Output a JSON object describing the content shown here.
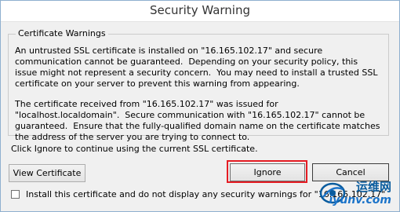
{
  "window": {
    "title": "Security Warning"
  },
  "warnings_group": {
    "legend": "Certificate Warnings",
    "paragraphs": [
      "An untrusted SSL certificate is installed on \"16.165.102.17\" and secure communication cannot be guaranteed.  Depending on your security policy, this issue might not represent a security concern.  You may need to install a trusted SSL certificate on your server to prevent this warning from appearing.",
      "The certificate received from \"16.165.102.17\" was issued for \"localhost.localdomain\".  Secure communication with \"16.165.102.17\" cannot be guaranteed.  Ensure that the fully-qualified domain name on the certificate matches the address of the server you are trying to connect to."
    ]
  },
  "prompt": "Click Ignore to continue using the current SSL certificate.",
  "buttons": {
    "view_certificate": "View Certificate",
    "ignore": "Ignore",
    "cancel": "Cancel"
  },
  "install_option": {
    "label": "Install this certificate and do not display any security warnings for \"16.165.102.17\"",
    "checked": false
  },
  "watermark": {
    "top": "运维网",
    "bottom": "iyunv.com"
  },
  "colors": {
    "highlight": "#e51c23",
    "watermark": "#0a5c9e"
  }
}
